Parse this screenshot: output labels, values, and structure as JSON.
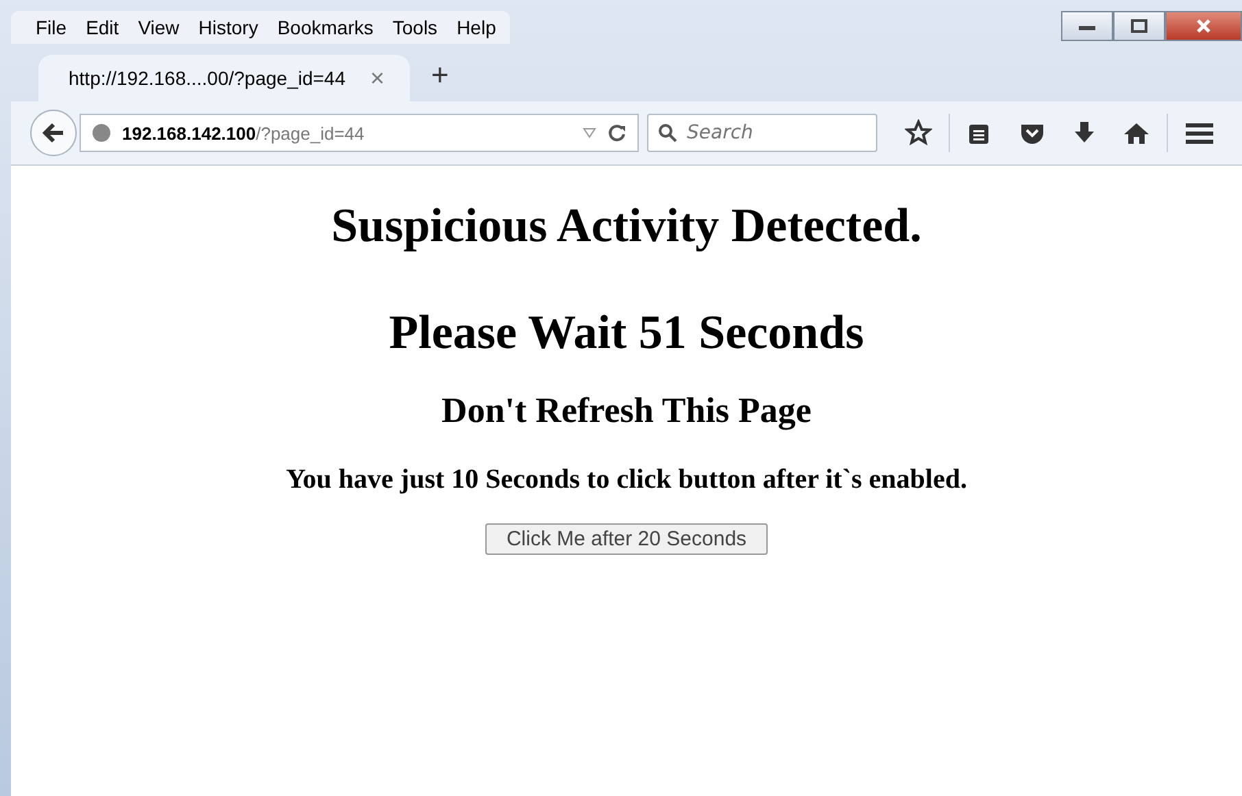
{
  "menu": [
    "File",
    "Edit",
    "View",
    "History",
    "Bookmarks",
    "Tools",
    "Help"
  ],
  "tabs": [
    {
      "title": "http://192.168....00/?page_id=44",
      "selected": true,
      "close": "×"
    }
  ],
  "new_tab": "+",
  "address": {
    "host": "192.168.142.100",
    "path": "/?page_id=44"
  },
  "search": {
    "placeholder": "Search"
  },
  "page": {
    "heading": "Suspicious Activity Detected.",
    "wait": "Please Wait 51 Seconds",
    "warning": "Don't Refresh This Page",
    "note": "You have just 10 Seconds to click button after it`s enabled.",
    "button": "Click Me after 20 Seconds"
  }
}
